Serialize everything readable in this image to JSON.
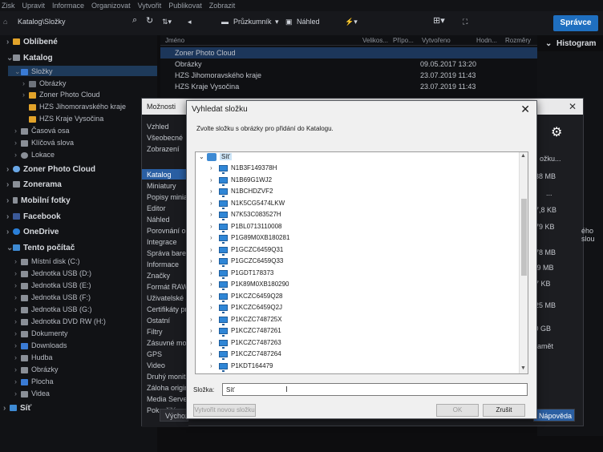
{
  "menu": [
    "Zisk",
    "Upravit",
    "Informace",
    "Organizovat",
    "Vytvořit",
    "Publikovat",
    "Zobrazit"
  ],
  "toolbar": {
    "path": "Katalog\\Složky",
    "pruzkumnik": "Průzkumník",
    "nahled": "Náhled",
    "spravce": "Správce",
    "histogram": "Histogram"
  },
  "tree": {
    "oblibene": "Oblíbené",
    "katalog": "Katalog",
    "slozky": "Složky",
    "obrazky": "Obrázky",
    "zoner_cloud_sub": "Zoner Photo Cloud",
    "hzs_jm": "HZS Jihomoravského kraje",
    "hzs_vys": "HZS Kraje Vysočina",
    "casova_osa": "Časová osa",
    "klicova_slova": "Klíčová slova",
    "lokace": "Lokace",
    "zoner_cloud": "Zoner Photo Cloud",
    "zonerama": "Zonerama",
    "mobilni": "Mobilní fotky",
    "facebook": "Facebook",
    "onedrive": "OneDrive",
    "tento_pocitac": "Tento počítač",
    "drives": [
      "Místní disk (C:)",
      "Jednotka USB (D:)",
      "Jednotka USB (E:)",
      "Jednotka USB (F:)",
      "Jednotka USB (G:)",
      "Jednotka DVD RW (H:)",
      "Dokumenty",
      "Downloads",
      "Hudba",
      "Obrázky",
      "Plocha",
      "Videa"
    ],
    "sit": "Síť"
  },
  "list": {
    "headers": [
      "Jméno",
      "Velikos...",
      "Přípo...",
      "Vytvořeno",
      "Hodn...",
      "Rozměry"
    ],
    "rows": [
      {
        "name": "Zoner Photo Cloud",
        "date": ""
      },
      {
        "name": "Obrázky",
        "date": "09.05.2017 13:20"
      },
      {
        "name": "HZS Jihomoravského kraje",
        "date": "23.07.2019 11:43"
      },
      {
        "name": "HZS Kraje Vysočina",
        "date": "23.07.2019 11:43"
      }
    ]
  },
  "moznosti": {
    "title": "Možnosti",
    "nav": [
      "Vzhled",
      "Všeobecné",
      "Zobrazení",
      "Katalog",
      "Miniatury",
      "Popisy minia",
      "Editor",
      "Náhled",
      "Porovnání ol",
      "Integrace",
      "Správa barev",
      "Informace",
      "Značky",
      "Formát RAW",
      "Uživatelské a",
      "Certifikáty pro",
      "Ostatní",
      "Filtry",
      "Zásuvné mod",
      "GPS",
      "Video",
      "Druhý monit",
      "Záloha origin",
      "Media Server",
      "Pokročilé"
    ],
    "selected_index": 3,
    "bottom_left": "Výchoz",
    "bottom_right": "Nápověda",
    "right_values": [
      "ožku...",
      "38 MB",
      "...",
      "7,8 KB",
      "79 KB",
      "78 MB",
      ",9 MB",
      "7 KB",
      "25 MB",
      "0,0 GB",
      "pamět",
      "ého slou"
    ]
  },
  "dialog": {
    "title": "Vyhledat složku",
    "instruction": "Zvolte složku s obrázky pro přidání do Katalogu.",
    "root": "Síť",
    "items": [
      "N1B3F149378H",
      "N1B69G1WJ2",
      "N1BCHDZVF2",
      "N1K5CG5474LKW",
      "N7K53C083527H",
      "P1BL0713110008",
      "P1G89M0XB180281",
      "P1GCZC6459Q31",
      "P1GCZC6459Q33",
      "P1GDT178373",
      "P1K89M0XB180290",
      "P1KCZC6459Q28",
      "P1KCZC6459Q2J",
      "P1KCZC748725X",
      "P1KCZC7487261",
      "P1KCZC7487263",
      "P1KCZC7487264",
      "P1KDT164479"
    ],
    "folder_label": "Složka:",
    "folder_value": "Síť",
    "new_folder": "Vytvořit novou složku",
    "ok": "OK",
    "cancel": "Zrušit"
  }
}
